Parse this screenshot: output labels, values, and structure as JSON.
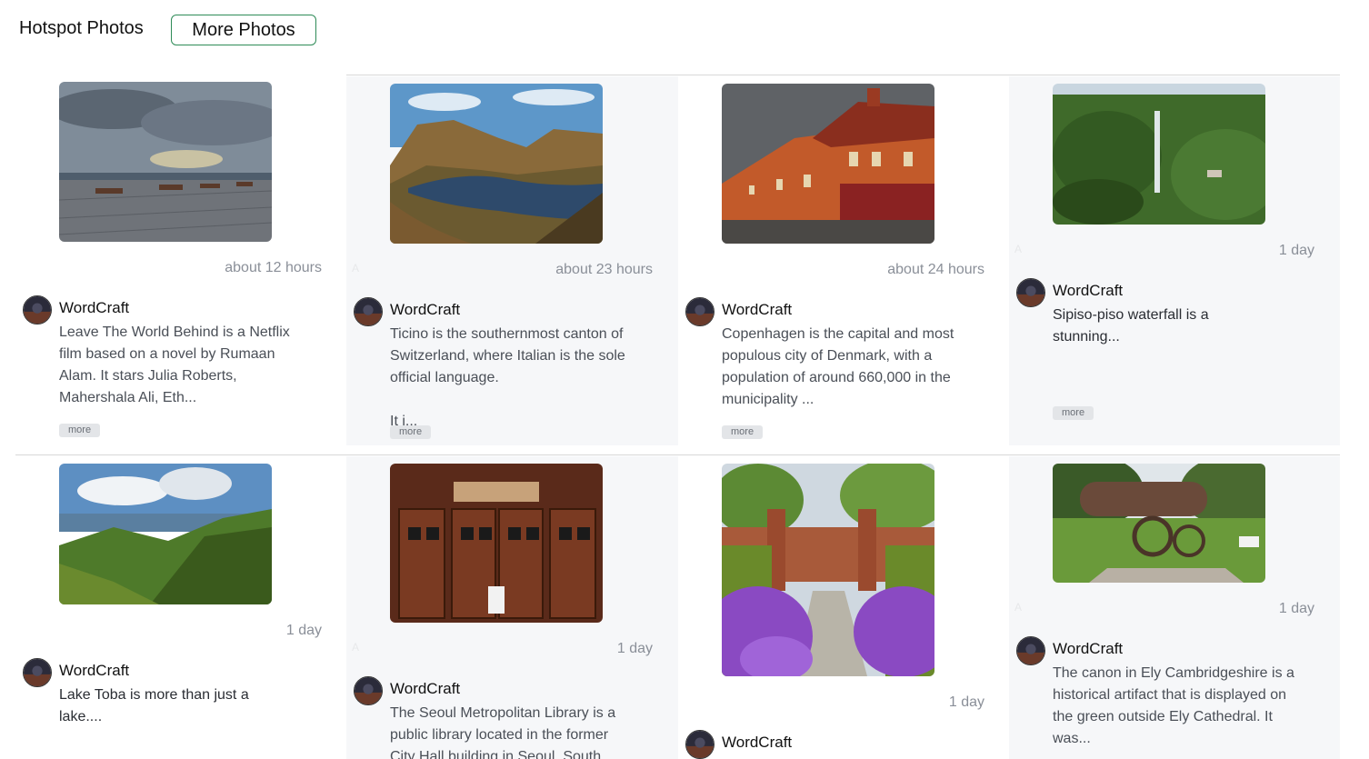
{
  "header": {
    "title": "Hotspot Photos",
    "more_photos_label": "More Photos"
  },
  "alt_marker": "A",
  "more_label": "more",
  "cards": [
    {
      "time": "about 12 hours",
      "author": "WordCraft",
      "description": "Leave The World Behind is a Netflix film based on a novel by Rumaan Alam. It stars Julia Roberts, Mahershala Ali, Eth...",
      "photo_alt": "Boardwalk with benches under cloudy sky by the sea"
    },
    {
      "time": "about 23 hours",
      "author": "WordCraft",
      "description": "Ticino is the southernmost canton of Switzerland, where Italian is the sole official language.",
      "description_extra": "It i...",
      "photo_alt": "Lake surrounded by mountains in Ticino"
    },
    {
      "time": "about 24 hours",
      "author": "WordCraft",
      "description": "Copenhagen is the capital and most populous city of Denmark, with a population of around 660,000 in the municipality ...",
      "photo_alt": "Orange houses in Copenhagen"
    },
    {
      "time": "1 day",
      "author": "WordCraft",
      "description": "Sipiso-piso waterfall is a stunning...",
      "photo_alt": "Sipiso-piso waterfall in green valley"
    },
    {
      "time": "1 day",
      "author": "WordCraft",
      "description": "Lake Toba is more than just a lake....",
      "photo_alt": "Lake Toba with green hills and clouds"
    },
    {
      "time": "1 day",
      "author": "WordCraft",
      "description": "The Seoul Metropolitan Library is a public library located in the former City Hall building in Seoul, South...",
      "photo_alt": "Wooden doors of Seoul Metropolitan Library"
    },
    {
      "time": "1 day",
      "author": "WordCraft",
      "description": "",
      "photo_alt": "Garden path with purple allium flowers"
    },
    {
      "time": "1 day",
      "author": "WordCraft",
      "description": "The canon in Ely Cambridgeshire is a historical artifact that is displayed on the green outside Ely Cathedral. It was...",
      "photo_alt": "Old cannon on the green outside Ely Cathedral"
    }
  ],
  "colors": {
    "accent_border": "#2e8b57",
    "shaded_card": "#f6f7f9",
    "time_text": "#8a8f98",
    "badge_bg": "#e3e5e8"
  }
}
